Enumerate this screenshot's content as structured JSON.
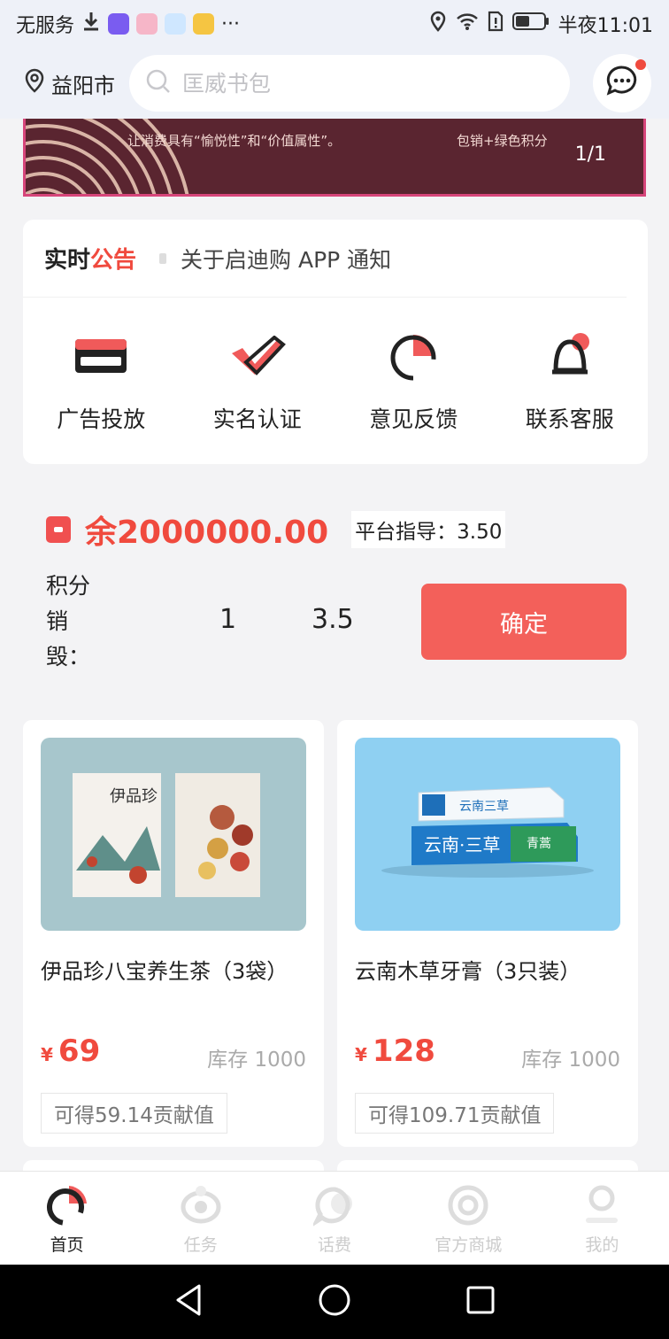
{
  "status_bar": {
    "carrier": "无服务",
    "overflow": "···",
    "time": "半夜11:01",
    "icons": [
      "download-icon",
      "app-icon",
      "app-icon",
      "app-icon",
      "app-icon",
      "location-icon",
      "wifi-icon",
      "sim-icon",
      "battery-icon"
    ]
  },
  "header": {
    "city": "益阳市",
    "search_placeholder": "匡威书包"
  },
  "banner": {
    "line1": "让消费具有“愉悦性”和“价值属性”。",
    "line2": "包销+绿色积分",
    "pager": "1/1"
  },
  "notice": {
    "title_a": "实时",
    "title_b": "公告",
    "text": "关于启迪购 APP 通知"
  },
  "quick_actions": [
    {
      "label": "广告投放",
      "icon": "card-icon"
    },
    {
      "label": "实名认证",
      "icon": "check-icon"
    },
    {
      "label": "意见反馈",
      "icon": "pie-icon"
    },
    {
      "label": "联系客服",
      "icon": "bell-icon"
    }
  ],
  "balance": {
    "amount": "余2000000.00",
    "guide": "平台指导：3.50"
  },
  "destroy": {
    "label": "积分销毁：",
    "quantity": "1",
    "value": "3.5",
    "confirm": "确定"
  },
  "products": [
    {
      "name": "伊品珍八宝养生茶（3袋）",
      "currency": "¥",
      "price": "69",
      "stock": "库存 1000",
      "contribution": "可得59.14贡献值"
    },
    {
      "name": "云南木草牙膏（3只装）",
      "currency": "¥",
      "price": "128",
      "stock": "库存 1000",
      "contribution": "可得109.71贡献值"
    }
  ],
  "tabs": [
    {
      "label": "首页",
      "icon": "home-icon",
      "active": true
    },
    {
      "label": "任务",
      "icon": "task-icon",
      "active": false
    },
    {
      "label": "话费",
      "icon": "phone-bill-icon",
      "active": false
    },
    {
      "label": "官方商城",
      "icon": "mall-icon",
      "active": false
    },
    {
      "label": "我的",
      "icon": "profile-icon",
      "active": false
    }
  ],
  "colors": {
    "accent": "#f04a3e",
    "button": "#f3605a",
    "background": "#f3f3f5"
  }
}
